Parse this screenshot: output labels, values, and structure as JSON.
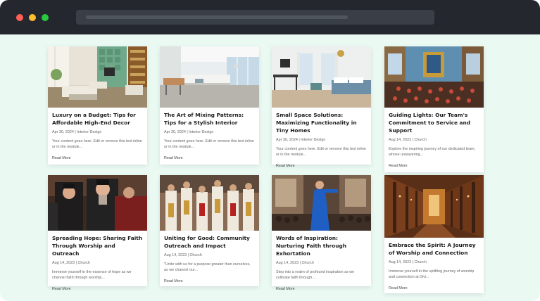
{
  "browser": {
    "url_text": ""
  },
  "cards": [
    {
      "title": "Luxury on a Budget: Tips for Affordable High-End Decor",
      "meta": "Apr 30, 2024 | Interior Design",
      "excerpt": "Your content goes here. Edit or remove this text inline or in the module...",
      "more": "Read More",
      "image": "living-room-photo"
    },
    {
      "title": "The Art of Mixing Patterns: Tips for a Stylish Interior",
      "meta": "Apr 30, 2024 | Interior Design",
      "excerpt": "Your content goes here. Edit or remove this text inline or in the module...",
      "more": "Read More",
      "image": "kitchen-photo"
    },
    {
      "title": "Small Space Solutions: Maximizing Functionality in Tiny Homes",
      "meta": "Apr 30, 2024 | Interior Design",
      "excerpt": "Your content goes here. Edit or remove this text inline or in the module...",
      "more": "Read More",
      "image": "bedroom-photo"
    },
    {
      "title": "Guiding Lights: Our Team's Commitment to Service and Support",
      "meta": "Aug 14, 2023 | Church",
      "excerpt": "Explore the inspiring journey of our dedicated team, whose unwavering...",
      "more": "Read More",
      "image": "church-interior-photo"
    },
    {
      "title": "Spreading Hope: Sharing Faith Through Worship and Outreach",
      "meta": "Aug 14, 2023 | Church",
      "excerpt": "Immerse yourself in the essence of hope as we channel faith through worship...",
      "more": "Read More",
      "image": "priests-photo"
    },
    {
      "title": "Uniting for Good: Community Outreach and Impact",
      "meta": "Aug 14, 2023 | Church",
      "excerpt": "\"Unite with us for a purpose greater than ourselves, as we channel our...",
      "more": "Read More",
      "image": "clergy-procession-photo"
    },
    {
      "title": "Words of Inspiration: Nurturing Faith through Exhortation",
      "meta": "Aug 14, 2023 | Church",
      "excerpt": "Step into a realm of profound inspiration as we cultivate faith through...",
      "more": "Read More",
      "image": "preacher-photo"
    },
    {
      "title": "Embrace the Spirit: A Journey of Worship and Connection",
      "meta": "Aug 14, 2023 | Church",
      "excerpt": "Immerse yourself in the uplifting journey of worship and connection at Divi...",
      "more": "Read More",
      "image": "cathedral-nave-photo"
    }
  ]
}
